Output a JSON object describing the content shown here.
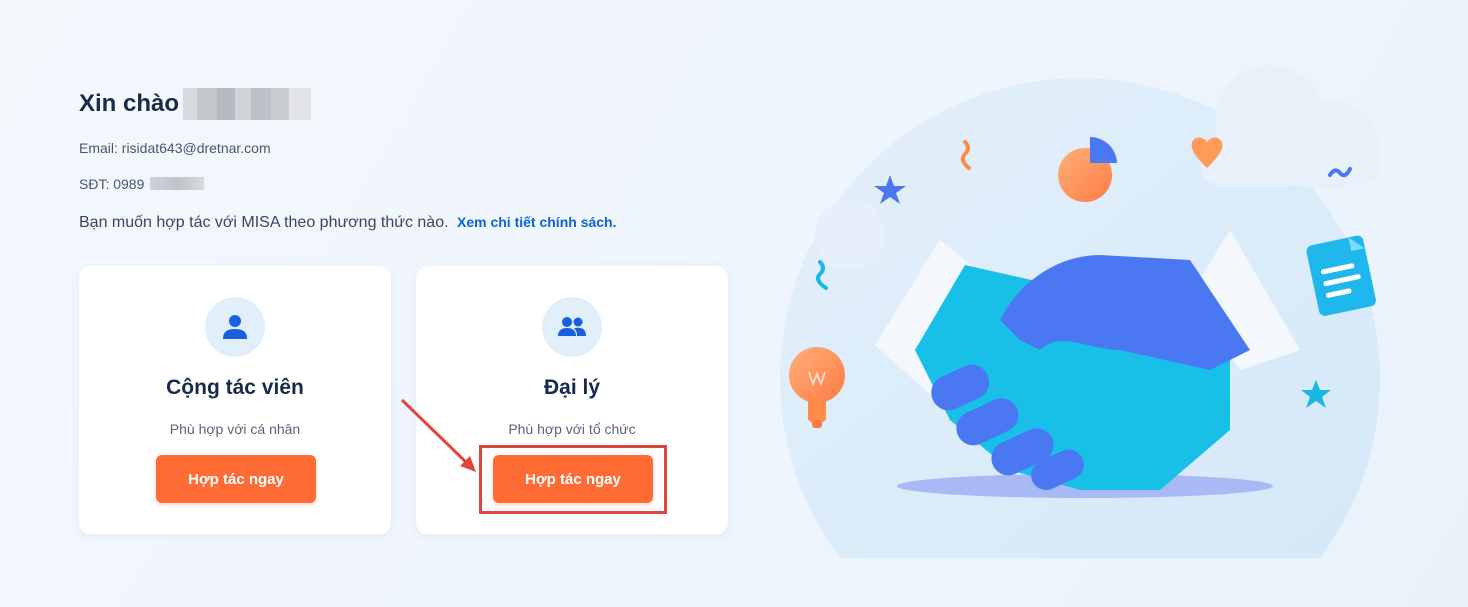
{
  "header": {
    "greeting": "Xin chào",
    "email_line": "Email: risidat643@dretnar.com",
    "phone_line": "SĐT: 0989",
    "question": "Bạn muốn hợp tác với MISA theo phương thức nào.",
    "policy_link": "Xem chi tiết chính sách."
  },
  "cards": [
    {
      "icon": "person-icon",
      "title": "Cộng tác viên",
      "subtitle": "Phù hợp với cá nhân",
      "button": "Hợp tác ngay"
    },
    {
      "icon": "group-icon",
      "title": "Đại lý",
      "subtitle": "Phù hợp với tổ chức",
      "button": "Hợp tác ngay"
    }
  ],
  "colors": {
    "primary_button": "#ff6b35",
    "link": "#0b63d6",
    "icon_blue": "#1a5fe0",
    "annotation_red": "#e0463f"
  }
}
